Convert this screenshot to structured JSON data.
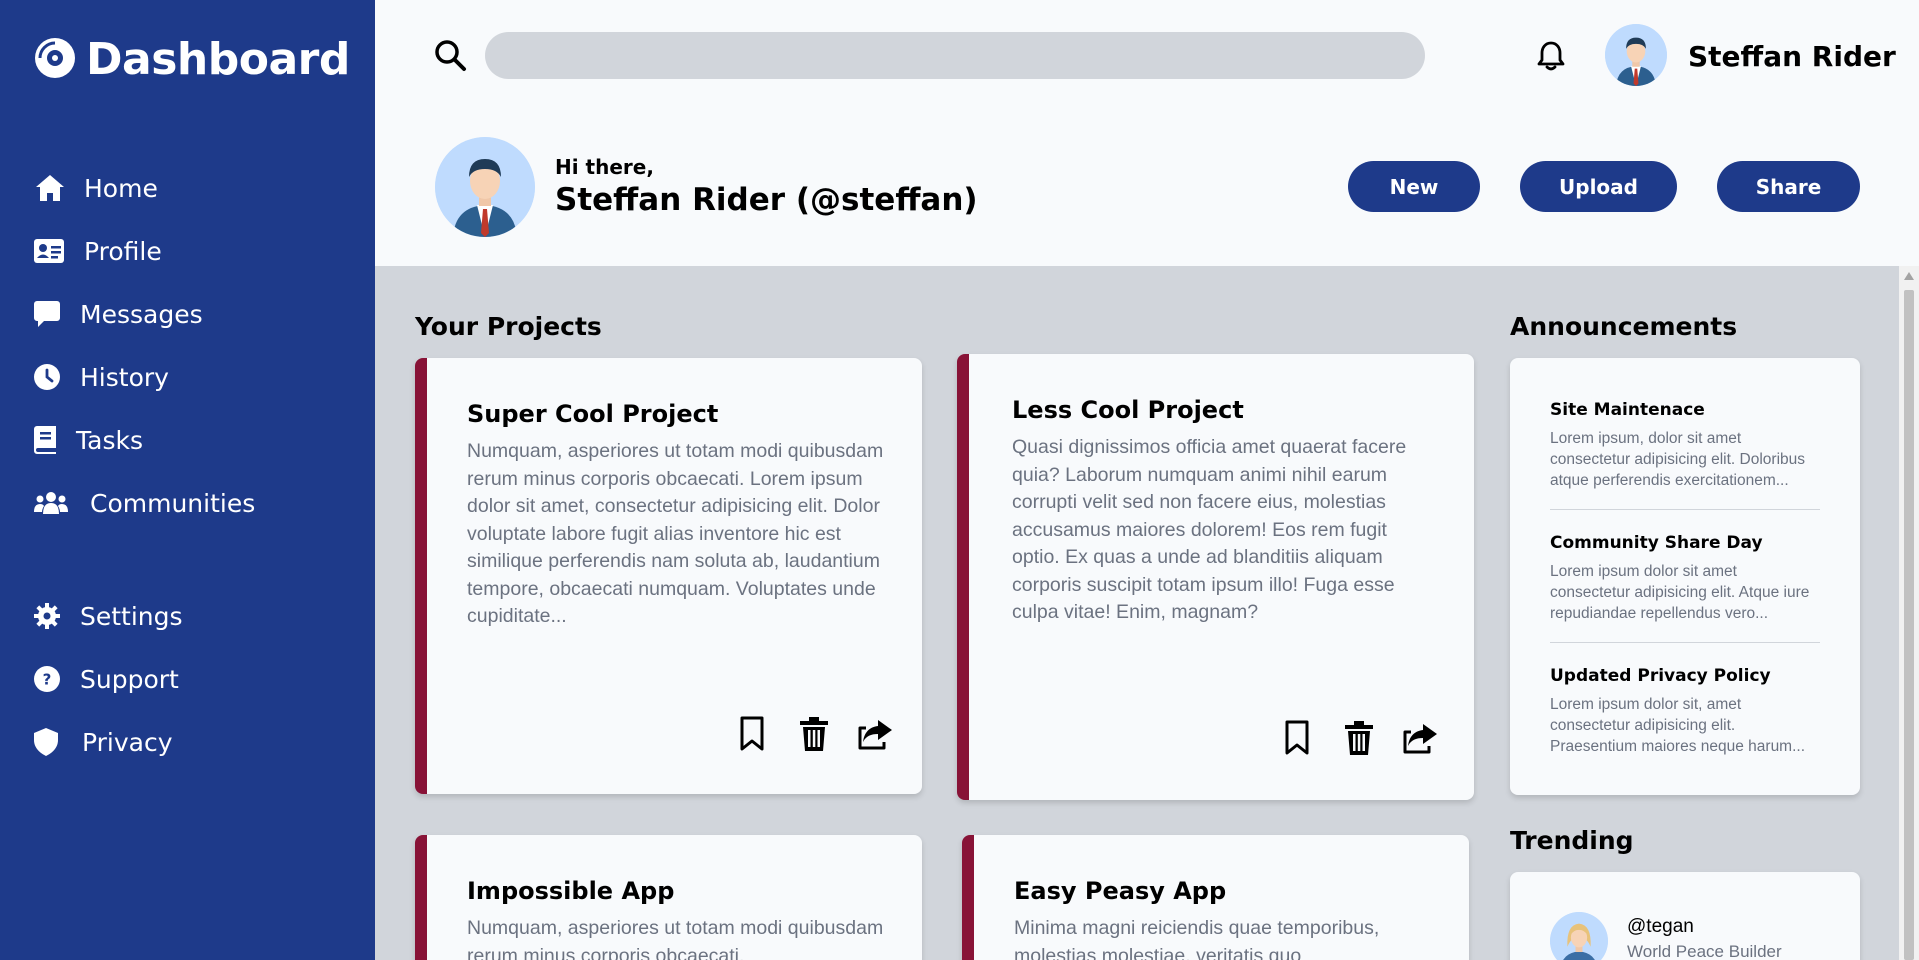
{
  "brand": {
    "title": "Dashboard",
    "icon": "disc-logo-icon"
  },
  "sidebar": {
    "items": [
      {
        "label": "Home",
        "icon": "home-icon"
      },
      {
        "label": "Profile",
        "icon": "id-card-icon"
      },
      {
        "label": "Messages",
        "icon": "message-icon"
      },
      {
        "label": "History",
        "icon": "clock-icon"
      },
      {
        "label": "Tasks",
        "icon": "book-icon"
      },
      {
        "label": "Communities",
        "icon": "users-icon"
      }
    ],
    "secondary": [
      {
        "label": "Settings",
        "icon": "gear-icon"
      },
      {
        "label": "Support",
        "icon": "question-icon"
      },
      {
        "label": "Privacy",
        "icon": "shield-icon"
      }
    ]
  },
  "header": {
    "search_value": "",
    "user_name": "Steffan Rider",
    "greeting": "Hi there,",
    "full_handle": "Steffan Rider (@steffan)",
    "buttons": {
      "new": "New",
      "upload": "Upload",
      "share": "Share"
    }
  },
  "projects": {
    "title": "Your Projects",
    "items": [
      {
        "title": "Super Cool Project",
        "text": "Numquam, asperiores ut totam modi quibusdam rerum minus corporis obcaecati. Lorem ipsum dolor sit amet, consectetur adipisicing elit. Dolor voluptate labore fugit alias inventore hic est similique perferendis nam soluta ab, laudantium tempore, obcaecati numquam. Voluptates unde cupiditate..."
      },
      {
        "title": "Less Cool Project",
        "text": "Quasi dignissimos officia amet quaerat facere quia? Laborum numquam animi nihil earum corrupti velit sed non facere eius, molestias accusamus maiores dolorem! Eos rem fugit optio. Ex quas a unde ad blanditiis aliquam corporis suscipit totam ipsum illo! Fuga esse culpa vitae! Enim, magnam?"
      },
      {
        "title": "Impossible App",
        "text": "Numquam, asperiores ut totam modi quibusdam rerum minus corporis obcaecati."
      },
      {
        "title": "Easy Peasy App",
        "text": "Minima magni reiciendis quae temporibus, molestias molestiae, veritatis quo"
      }
    ]
  },
  "announcements": {
    "title": "Announcements",
    "items": [
      {
        "title": "Site Maintenace",
        "text": "Lorem ipsum, dolor sit amet consectetur adipisicing elit. Doloribus atque perferendis exercitationem..."
      },
      {
        "title": "Community Share Day",
        "text": "Lorem ipsum dolor sit amet consectetur adipisicing elit. Atque iure repudiandae repellendus vero..."
      },
      {
        "title": "Updated Privacy Policy",
        "text": "Lorem ipsum dolor sit, amet consectetur adipisicing elit. Praesentium maiores neque harum..."
      }
    ]
  },
  "trending": {
    "title": "Trending",
    "items": [
      {
        "handle": "@tegan",
        "subtitle": "World Peace Builder"
      }
    ]
  },
  "colors": {
    "sidebar": "#1e3a8a",
    "accent": "#1e3a8a",
    "card_border": "#881337",
    "background": "#d1d5db",
    "surface": "#f8fafc"
  }
}
